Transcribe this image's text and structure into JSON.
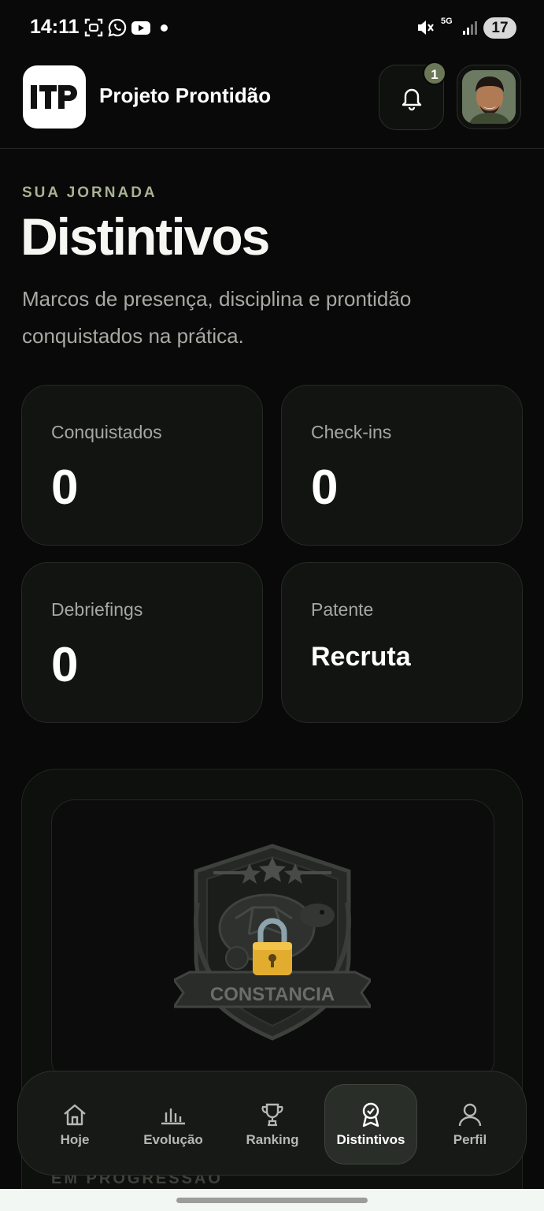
{
  "status_bar": {
    "time": "14:11",
    "battery": "17",
    "network": "5G"
  },
  "header": {
    "logo_text": "ITP",
    "app_title": "Projeto Prontidão",
    "notification_count": "1"
  },
  "hero": {
    "eyebrow": "SUA JORNADA",
    "title": "Distintivos",
    "subtitle": "Marcos de presença, disciplina e prontidão conquistados na prática."
  },
  "stats": [
    {
      "label": "Conquistados",
      "value": "0"
    },
    {
      "label": "Check-ins",
      "value": "0"
    },
    {
      "label": "Debriefings",
      "value": "0"
    },
    {
      "label": "Patente",
      "value": "Recruta"
    }
  ],
  "badge": {
    "name": "CONSTANCIA",
    "locked": true,
    "section_label": "EM PROGRESSÃO"
  },
  "nav": [
    {
      "label": "Hoje",
      "icon": "home-icon",
      "active": false
    },
    {
      "label": "Evolução",
      "icon": "chart-icon",
      "active": false
    },
    {
      "label": "Ranking",
      "icon": "trophy-icon",
      "active": false
    },
    {
      "label": "Distintivos",
      "icon": "badge-icon",
      "active": true
    },
    {
      "label": "Perfil",
      "icon": "user-icon",
      "active": false
    }
  ],
  "colors": {
    "accent": "#a9b293",
    "badge_bg": "#6b7756",
    "background": "#080908",
    "card": "#121412"
  }
}
